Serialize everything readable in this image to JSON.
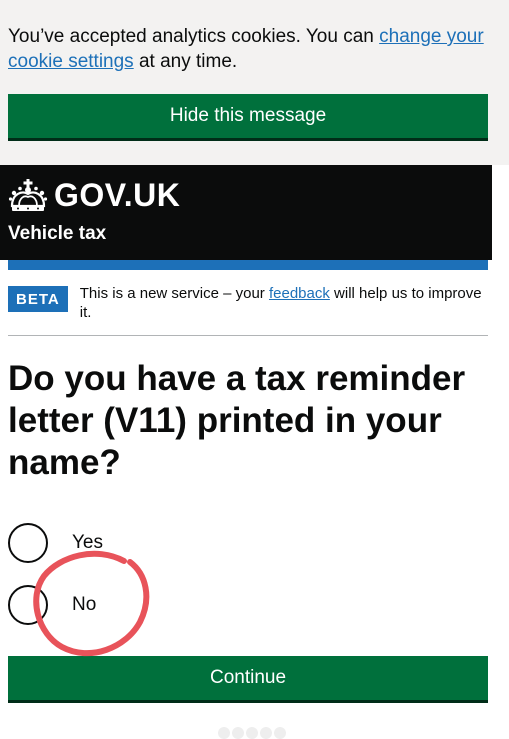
{
  "cookie_banner": {
    "text_before": "You’ve accepted analytics cookies. You can ",
    "link_text": "change your cookie settings",
    "text_after": " at any time.",
    "hide_button_label": "Hide this message"
  },
  "header": {
    "logo_text": "GOV.UK",
    "service_name": "Vehicle tax"
  },
  "phase_banner": {
    "tag": "BETA",
    "text_before": "This is a new service – your ",
    "link_text": "feedback",
    "text_after": " will help us to improve it."
  },
  "question": {
    "title": "Do you have a tax reminder letter (V11) printed in your name?",
    "options": [
      {
        "label": "Yes",
        "selected": false
      },
      {
        "label": "No",
        "selected": false
      }
    ]
  },
  "continue_button_label": "Continue",
  "colors": {
    "govuk_green": "#00703c",
    "govuk_blue": "#1d70b8",
    "header_black": "#0b0c0c",
    "banner_grey": "#f3f2f1",
    "annotation_red": "#e8535a"
  },
  "icons": {
    "logo": "crown-icon",
    "annotation": "hand-drawn-circle"
  }
}
